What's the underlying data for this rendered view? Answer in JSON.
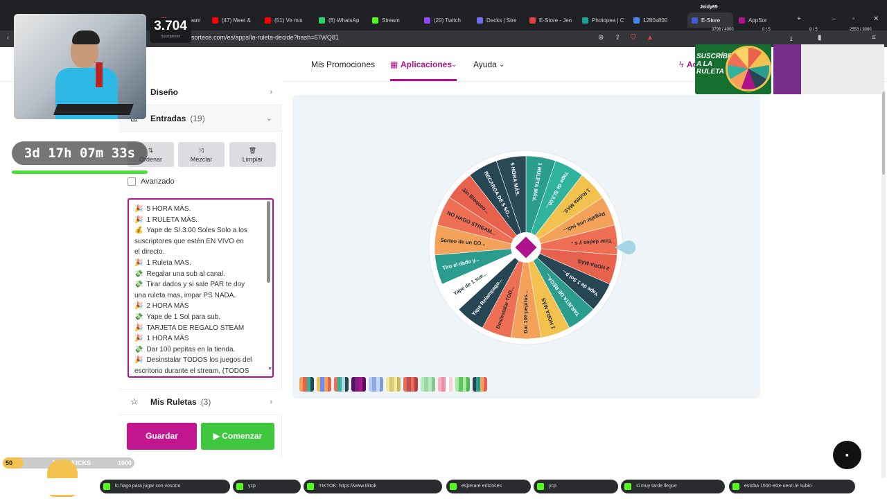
{
  "browser": {
    "tabs": [
      {
        "label": "NT · Stream",
        "color": "#c62828"
      },
      {
        "label": "(47) Meet &",
        "color": "#ff0000"
      },
      {
        "label": "(51) Ve mis",
        "color": "#ff0000"
      },
      {
        "label": "(8) WhatsAp",
        "color": "#25d366"
      },
      {
        "label": "Stream",
        "color": "#53fc18"
      },
      {
        "label": "(20) Twitch",
        "color": "#9146ff"
      },
      {
        "label": "Decks | Stre",
        "color": "#6e6ef5"
      },
      {
        "label": "E-Store - Jen",
        "color": "#e04040"
      },
      {
        "label": "Photopea | C",
        "color": "#18a497"
      },
      {
        "label": "1280x800",
        "color": "#4285f4"
      },
      {
        "label": "E-Store",
        "color": "#3b5bdb"
      },
      {
        "label": "AppSor",
        "color": "#b0128c"
      }
    ],
    "url": "sorteos.com/es/apps/la-ruleta-decide?hash=67WQ81",
    "profile": "Jeidy65",
    "counters": [
      "3798 / 4000",
      "0 / 5",
      "8 / 5",
      "2553 / 3000"
    ]
  },
  "site": {
    "nav": {
      "promos": "Mis Promociones",
      "apps": "Aplicaciones",
      "help": "Ayuda",
      "extra": "Ac"
    }
  },
  "panel": {
    "design": "Diseño",
    "entries_title": "Entradas",
    "entries_count": "(19)",
    "sort": "Ordenar",
    "shuffle": "Mezclar",
    "clear": "Limpiar",
    "advanced": "Avanzado",
    "my_wheels": "Mis Ruletas",
    "my_wheels_count": "(3)",
    "save": "Guardar",
    "start": "Comenzar"
  },
  "entries": [
    {
      "icon": "🎉",
      "text": "5 HORA MÁS."
    },
    {
      "icon": "🎉",
      "text": "1 RULETA MÁS."
    },
    {
      "icon": "💰",
      "text": "Yape de S/.3.00 Soles Solo a los"
    },
    {
      "icon": "",
      "text": "suscriptores que estén EN VIVO en"
    },
    {
      "icon": "",
      "text": "el directo."
    },
    {
      "icon": "🎉",
      "text": "1 Ruleta MAS."
    },
    {
      "icon": "💸",
      "text": "Regalar una sub al canal."
    },
    {
      "icon": "💸",
      "text": "Tirar dados y si sale PAR te doy"
    },
    {
      "icon": "",
      "text": "una ruleta mas, impar PS NADA."
    },
    {
      "icon": "🎉",
      "text": "2 HORA MÁS"
    },
    {
      "icon": "💸",
      "text": "Yape de 1 Sol para sub."
    },
    {
      "icon": "🎉",
      "text": "TARJETA DE REGALO STEAM"
    },
    {
      "icon": "🎉",
      "text": "1 HORA MÁS"
    },
    {
      "icon": "💸",
      "text": "Dar 100 pepitas en la tienda."
    },
    {
      "icon": "🎉",
      "text": "Desinstalar TODOS los juegos del"
    },
    {
      "icon": "",
      "text": "escritorio durante el stream, (TODOS"
    }
  ],
  "wheel": {
    "segments": [
      {
        "label": "1 RULETA MÁS.",
        "color": "#2a9d8f"
      },
      {
        "label": "Yape de S/.3.00...",
        "color": "#2fb39c"
      },
      {
        "label": "1 Ruleta MAS.",
        "color": "#f2c14e"
      },
      {
        "label": "Regalar una sub...",
        "color": "#f4a259"
      },
      {
        "label": "Tirar dados y s...",
        "color": "#ef6f55"
      },
      {
        "label": "2 HORA MÁS",
        "color": "#e8614d"
      },
      {
        "label": "Yape de 1 Sol p...",
        "color": "#264653"
      },
      {
        "label": "TARJETA DE REGA...",
        "color": "#2a9d8f"
      },
      {
        "label": "1 HORA MÁS",
        "color": "#f2c14e"
      },
      {
        "label": "Dar 100 pepitas...",
        "color": "#f4a259"
      },
      {
        "label": "Desinstalar TOD...",
        "color": "#ef6f55"
      },
      {
        "label": "Yape Relampago...",
        "color": "#264653"
      },
      {
        "label": "Yape de 1 sue...",
        "color": "#ffffff"
      },
      {
        "label": "Tiro el dado y...",
        "color": "#2a9d8f"
      },
      {
        "label": "Sorteo de un CO...",
        "color": "#f4a259"
      },
      {
        "label": "NO HAGO STREAM...",
        "color": "#ef6f55"
      },
      {
        "label": "Sin Bloqueo...",
        "color": "#e8614d"
      },
      {
        "label": "RECARGA DE 5 SO...",
        "color": "#264653"
      },
      {
        "label": "5 HORA MÁS.",
        "color": "#2a4a55"
      }
    ],
    "center_color": "#b0128c"
  },
  "palettes": [
    [
      "#f4a259",
      "#e8614d",
      "#2fb39c",
      "#264653"
    ],
    [
      "#f2c14e",
      "#6b8cff",
      "#f4a259",
      "#e8614d"
    ],
    [
      "#ef6f55",
      "#2fb39c",
      "#b0d8e0",
      "#264653"
    ],
    [
      "#5a1060",
      "#7a2080",
      "#b0128c",
      "#5a1060"
    ],
    [
      "#b8c8f0",
      "#8fa8e8",
      "#c8d8f8",
      "#7f9ad8"
    ],
    [
      "#f2e8a0",
      "#d8c870",
      "#f2e8a0",
      "#c8b860"
    ],
    [
      "#e86a5a",
      "#c05050",
      "#e86a5a",
      "#b04040"
    ],
    [
      "#b8e8c0",
      "#98d8a0",
      "#b8e8c0",
      "#88c890"
    ],
    [
      "#f8b0c0",
      "#f090a8",
      "#ffffff",
      "#f8d0d8"
    ],
    [
      "#a8e8a0",
      "#60c860",
      "#a8e8a0",
      "#50b850"
    ],
    [
      "#264653",
      "#2a9d8f",
      "#f4a259",
      "#e8614d"
    ]
  ],
  "stream": {
    "subs": "3.704",
    "subs_label": "Suscriptores",
    "timer": "3d 17h 07m 33s",
    "goal_start": "50",
    "goal_label": "META KICKS",
    "goal_end": "1000",
    "promo_text": "SUSCRÍBETE A LA RULETA",
    "chat": [
      "lo hago para jugar con vosotro",
      "ycp",
      "TIKTOK: https://www.tiktok",
      "esperare entonces",
      "ycp",
      "si muy tarde llegue",
      "estoba 1500 este ueon le subio"
    ]
  }
}
